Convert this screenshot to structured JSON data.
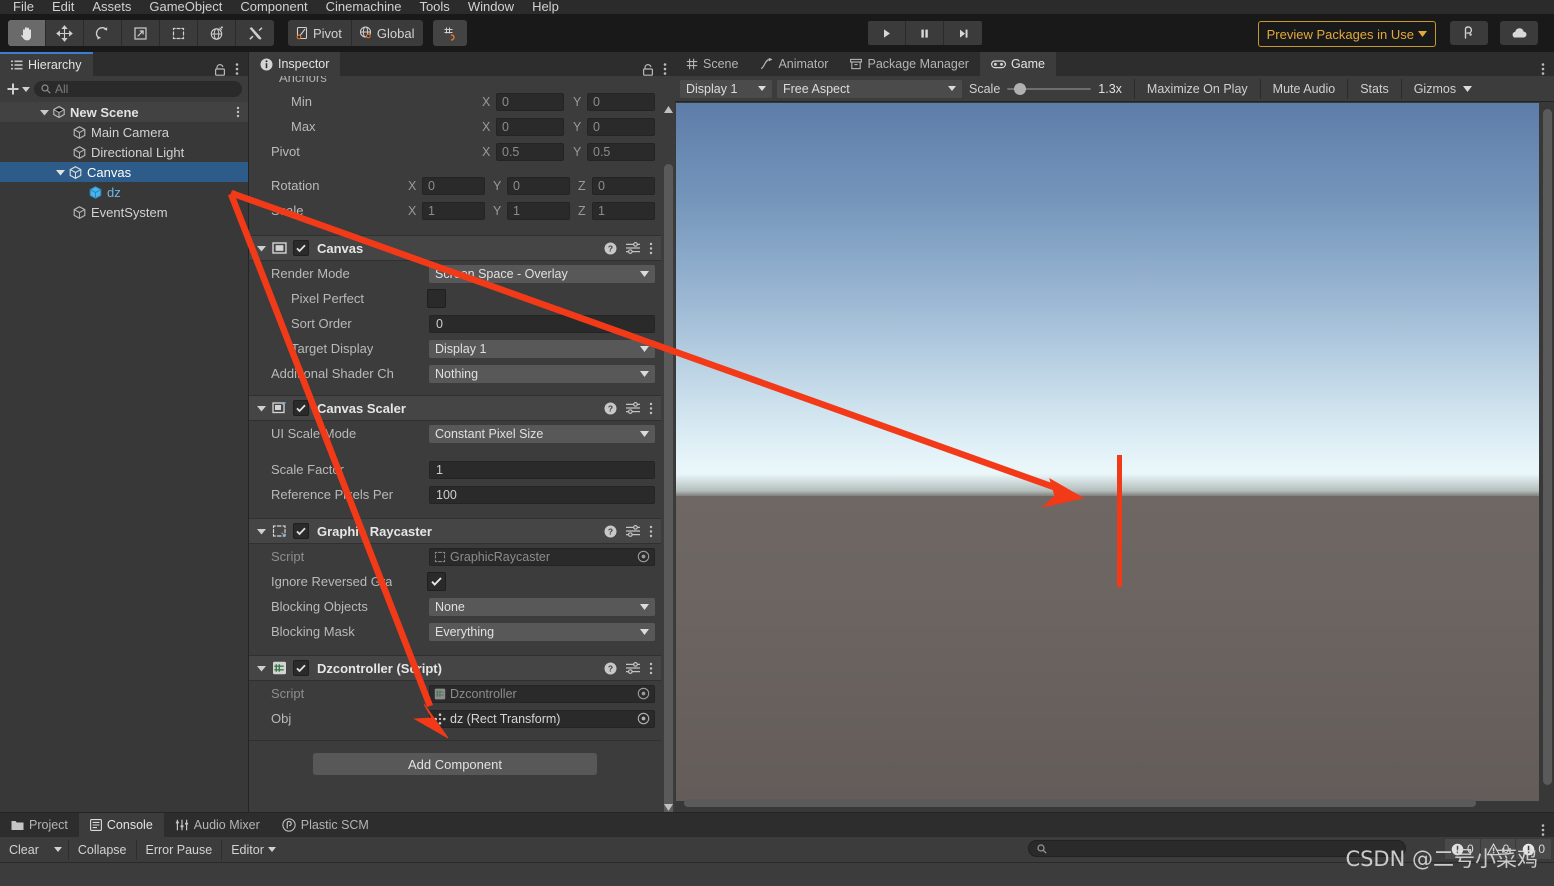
{
  "menu": {
    "items": [
      "File",
      "Edit",
      "Assets",
      "GameObject",
      "Component",
      "Cinemachine",
      "Tools",
      "Window",
      "Help"
    ]
  },
  "toolbar": {
    "tools": [
      {
        "name": "hand-tool",
        "icon": "hand-icon",
        "active": true
      },
      {
        "name": "move-tool",
        "icon": "move-arrows-icon",
        "active": false
      },
      {
        "name": "rotate-tool",
        "icon": "rotate-icon",
        "active": false
      },
      {
        "name": "scale-tool",
        "icon": "scale-icon",
        "active": false
      },
      {
        "name": "rect-tool",
        "icon": "rect-transform-icon",
        "active": false
      },
      {
        "name": "transform-tool",
        "icon": "combined-transform-icon",
        "active": false
      },
      {
        "name": "custom-editor-tool",
        "icon": "wrench-screwdriver-icon",
        "active": false
      }
    ],
    "pivot_label": "Pivot",
    "global_label": "Global",
    "grid_icon": "grid-snap-icon",
    "play_label": "play-icon",
    "pause_label": "pause-icon",
    "step_label": "step-icon",
    "preview_packages": "Preview Packages in Use",
    "cloud_icon": "cloud-icon",
    "collab_icon": "plastic-scm-icon"
  },
  "hierarchy": {
    "tab_label": "Hierarchy",
    "tab_icon": "hierarchy-icon",
    "lock_icon": "lock-icon",
    "menu_icon": "kebab-icon",
    "add_label": "+",
    "search_placeholder": "All",
    "search_value": "",
    "tree": [
      {
        "label": "New Scene",
        "depth": 0,
        "icon": "scene-icon",
        "expanded": true,
        "selected": false,
        "is_scene": true
      },
      {
        "label": "Main Camera",
        "depth": 1,
        "icon": "gameobject-icon",
        "expanded": false,
        "selected": false
      },
      {
        "label": "Directional Light",
        "depth": 1,
        "icon": "gameobject-icon",
        "expanded": false,
        "selected": false
      },
      {
        "label": "Canvas",
        "depth": 1,
        "icon": "gameobject-icon",
        "expanded": true,
        "selected": true
      },
      {
        "label": "dz",
        "depth": 2,
        "icon": "prefab-icon",
        "expanded": false,
        "selected": false,
        "prefab": true
      },
      {
        "label": "EventSystem",
        "depth": 1,
        "icon": "gameobject-icon",
        "expanded": false,
        "selected": false
      }
    ]
  },
  "inspector": {
    "tab_label": "Inspector",
    "tab_icon": "info-icon",
    "lock_icon": "lock-icon",
    "menu_icon": "kebab-icon",
    "clipped_label": "Anchors",
    "rect_transform": {
      "rows": [
        {
          "label": "Min",
          "indent": true,
          "fields": [
            {
              "axis": "X",
              "value": "0"
            },
            {
              "axis": "Y",
              "value": "0"
            }
          ]
        },
        {
          "label": "Max",
          "indent": true,
          "fields": [
            {
              "axis": "X",
              "value": "0"
            },
            {
              "axis": "Y",
              "value": "0"
            }
          ]
        },
        {
          "label": "Pivot",
          "indent": false,
          "fields": [
            {
              "axis": "X",
              "value": "0.5"
            },
            {
              "axis": "Y",
              "value": "0.5"
            }
          ]
        }
      ],
      "rows3": [
        {
          "label": "Rotation",
          "fields": [
            {
              "axis": "X",
              "value": "0"
            },
            {
              "axis": "Y",
              "value": "0"
            },
            {
              "axis": "Z",
              "value": "0"
            }
          ]
        },
        {
          "label": "Scale",
          "fields": [
            {
              "axis": "X",
              "value": "1"
            },
            {
              "axis": "Y",
              "value": "1"
            },
            {
              "axis": "Z",
              "value": "1"
            }
          ]
        }
      ]
    },
    "components": [
      {
        "name": "Canvas",
        "icon": "canvas-icon",
        "enabled": true,
        "help_icon": "help-icon",
        "preset_icon": "preset-icon",
        "menu_icon": "kebab-icon",
        "props": [
          {
            "label": "Render Mode",
            "indent": false,
            "type": "dropdown",
            "value": "Screen Space - Overlay"
          },
          {
            "label": "Pixel Perfect",
            "indent": true,
            "type": "checkbox",
            "value": false
          },
          {
            "label": "Sort Order",
            "indent": true,
            "type": "text",
            "value": "0"
          },
          {
            "label": "Target Display",
            "indent": true,
            "type": "dropdown",
            "value": "Display 1"
          },
          {
            "label": "Additional Shader Ch",
            "indent": false,
            "type": "dropdown",
            "value": "Nothing"
          }
        ]
      },
      {
        "name": "Canvas Scaler",
        "icon": "canvas-scaler-icon",
        "enabled": true,
        "help_icon": "help-icon",
        "preset_icon": "preset-icon",
        "menu_icon": "kebab-icon",
        "props": [
          {
            "label": "UI Scale Mode",
            "indent": false,
            "type": "dropdown",
            "value": "Constant Pixel Size"
          },
          {
            "label": "",
            "indent": false,
            "type": "spacer",
            "value": ""
          },
          {
            "label": "Scale Factor",
            "indent": false,
            "type": "text",
            "value": "1"
          },
          {
            "label": "Reference Pixels Per",
            "indent": false,
            "type": "text",
            "value": "100"
          }
        ]
      },
      {
        "name": "Graphic Raycaster",
        "icon": "graphic-raycaster-icon",
        "enabled": true,
        "help_icon": "help-icon",
        "preset_icon": "preset-icon",
        "menu_icon": "kebab-icon",
        "props": [
          {
            "label": "Script",
            "indent": false,
            "type": "objref-dim",
            "value": "GraphicRaycaster",
            "oicon": "script-ref-icon"
          },
          {
            "label": "Ignore Reversed Gra",
            "indent": false,
            "type": "checkbox",
            "value": true
          },
          {
            "label": "Blocking Objects",
            "indent": false,
            "type": "dropdown",
            "value": "None"
          },
          {
            "label": "Blocking Mask",
            "indent": false,
            "type": "dropdown",
            "value": "Everything"
          }
        ]
      },
      {
        "name": "Dzcontroller (Script)",
        "icon": "csharp-script-icon",
        "enabled": true,
        "help_icon": "help-icon",
        "preset_icon": "preset-icon",
        "menu_icon": "kebab-icon",
        "props": [
          {
            "label": "Script",
            "indent": false,
            "type": "objref-dim",
            "value": "Dzcontroller",
            "oicon": "script-ref-icon"
          },
          {
            "label": "Obj",
            "indent": false,
            "type": "objref",
            "value": "dz (Rect Transform)",
            "oicon": "rect-transform-ref-icon"
          }
        ]
      }
    ],
    "add_component_label": "Add Component"
  },
  "game_panel": {
    "tabs": [
      {
        "label": "Scene",
        "icon": "scene-grid-icon",
        "selected": false
      },
      {
        "label": "Animator",
        "icon": "animator-icon",
        "selected": false
      },
      {
        "label": "Package Manager",
        "icon": "package-icon",
        "selected": false
      },
      {
        "label": "Game",
        "icon": "gamepad-icon",
        "selected": true
      }
    ],
    "menu_icon": "kebab-icon",
    "display": "Display 1",
    "aspect": "Free Aspect",
    "scale_label": "Scale",
    "scale_value": "1.3x",
    "maximize_on_play": "Maximize On Play",
    "mute_audio": "Mute Audio",
    "stats": "Stats",
    "gizmos": "Gizmos",
    "sky_top_color": "#5d7da9",
    "sky_horizon_color": "#edf7f8",
    "ground_color": "#6b6461",
    "dz_object_color": "#f23a18"
  },
  "console": {
    "tabs": [
      {
        "label": "Project",
        "icon": "folder-icon",
        "selected": false
      },
      {
        "label": "Console",
        "icon": "console-icon",
        "selected": true
      },
      {
        "label": "Audio Mixer",
        "icon": "audio-mixer-icon",
        "selected": false
      },
      {
        "label": "Plastic SCM",
        "icon": "plastic-scm-icon",
        "selected": false
      }
    ],
    "menu_icon": "kebab-icon",
    "clear_label": "Clear",
    "collapse_label": "Collapse",
    "error_pause_label": "Error Pause",
    "editor_label": "Editor",
    "search_value": "",
    "counts": {
      "errors": "0",
      "warnings": "0",
      "logs": "0"
    }
  },
  "annotation": {
    "color": "#f23a18",
    "watermark": "CSDN @二号小菜鸡"
  }
}
